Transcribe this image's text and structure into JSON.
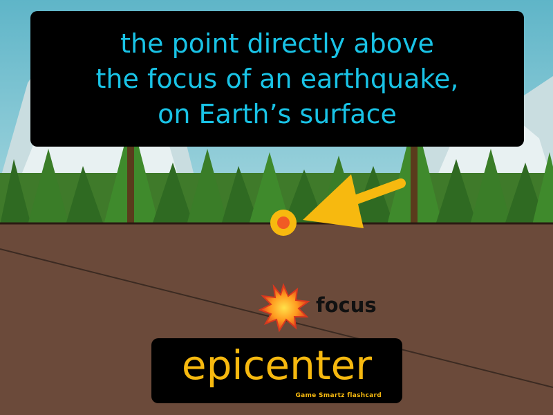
{
  "definition": {
    "lines": [
      "the point directly above",
      "the focus of an earthquake,",
      "on Earth’s surface"
    ]
  },
  "labels": {
    "focus": "focus"
  },
  "term": {
    "word": "epicenter",
    "brand": "Game Smartz flashcard"
  },
  "colors": {
    "sky": "#6ebfcf",
    "mountain": "#cfe0e2",
    "ground": "#6b4a3a",
    "definition_text": "#19c3e6",
    "term_text": "#f7b90f",
    "arrow": "#f7b90f",
    "epicenter_dot": "#f15a24"
  },
  "icons": {
    "pointer": "arrow-icon",
    "epicenter_marker": "epicenter-dot-icon",
    "focus_marker": "explosion-icon"
  }
}
